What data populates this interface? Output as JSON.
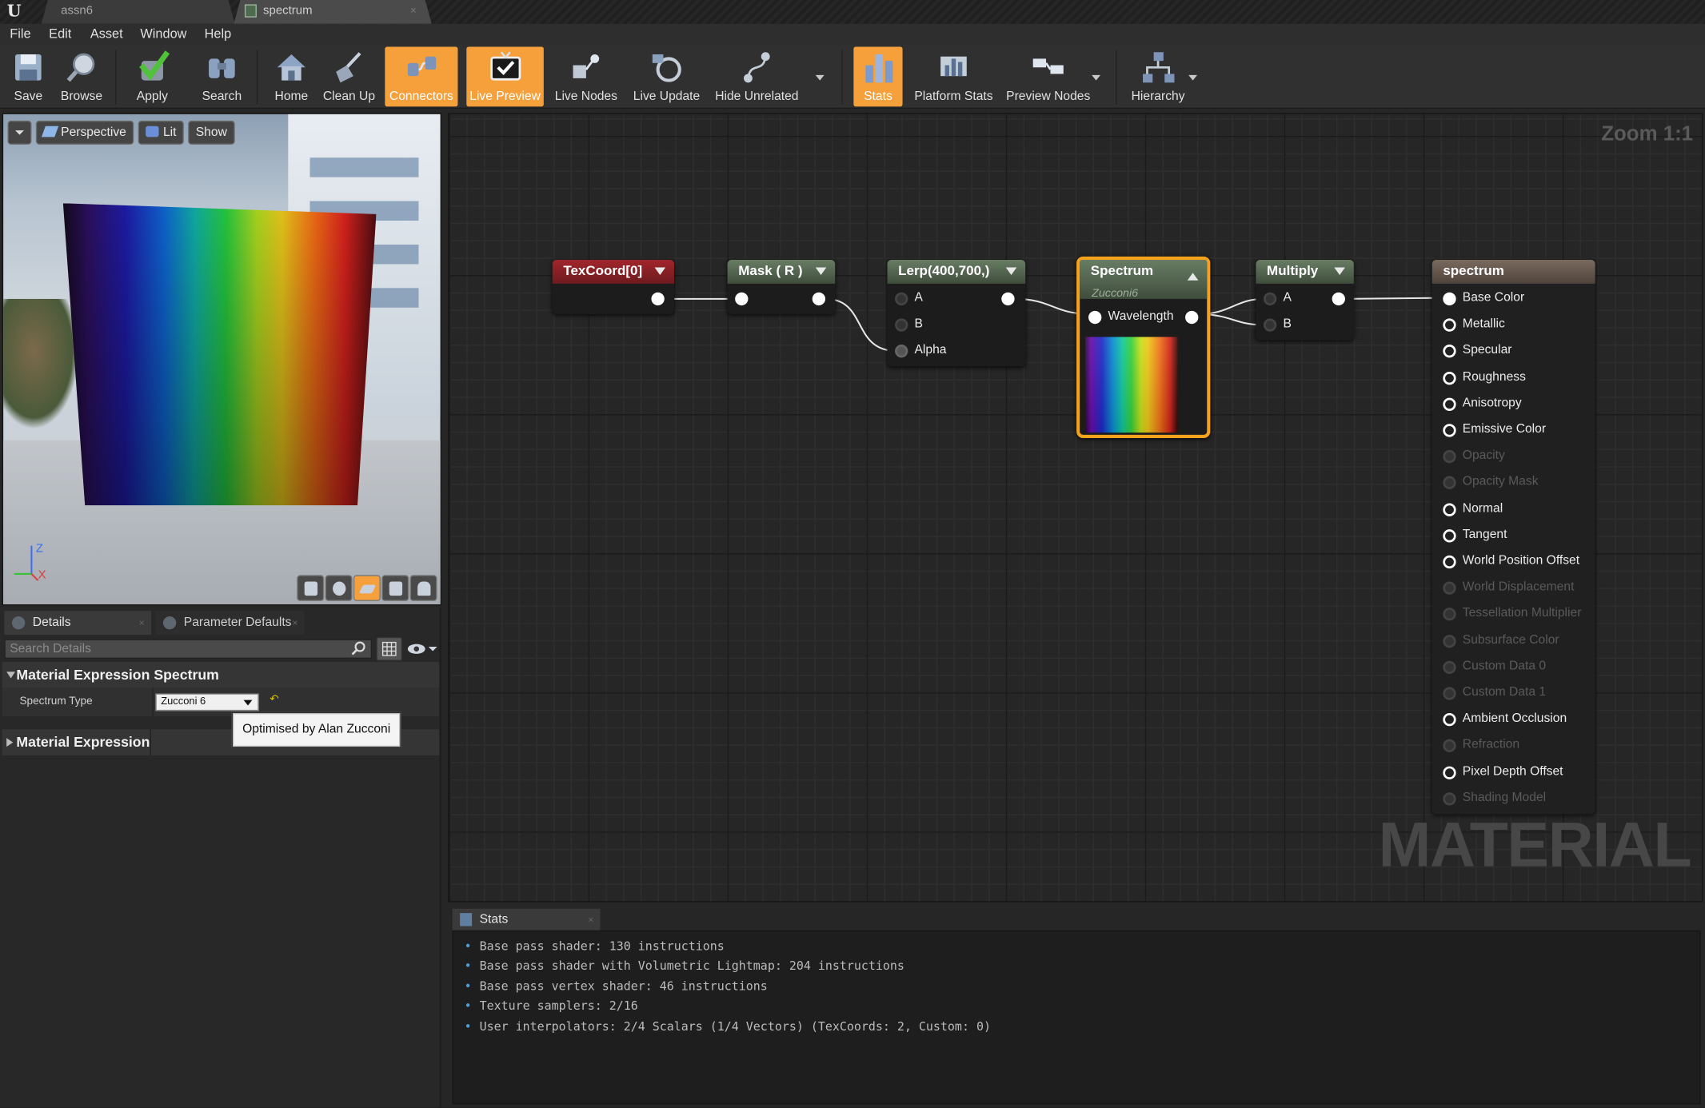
{
  "tabs": [
    {
      "label": "assn6"
    },
    {
      "label": "spectrum"
    }
  ],
  "menu": [
    "File",
    "Edit",
    "Asset",
    "Window",
    "Help"
  ],
  "toolbar": {
    "buttons": [
      {
        "label": "Save",
        "icon": "save-icon"
      },
      {
        "label": "Browse",
        "icon": "browse-icon"
      },
      {
        "label": "Apply",
        "icon": "apply-check-icon"
      },
      {
        "label": "Search",
        "icon": "search-binoculars-icon"
      },
      {
        "label": "Home",
        "icon": "home-icon"
      },
      {
        "label": "Clean Up",
        "icon": "broom-icon"
      },
      {
        "label": "Connectors",
        "icon": "connectors-icon",
        "active": true
      },
      {
        "label": "Live Preview",
        "icon": "tv-check-icon",
        "active": true
      },
      {
        "label": "Live Nodes",
        "icon": "live-nodes-icon"
      },
      {
        "label": "Live Update",
        "icon": "live-update-icon"
      },
      {
        "label": "Hide Unrelated",
        "icon": "hide-unrelated-icon"
      },
      {
        "label": "Stats",
        "icon": "stats-bars-icon",
        "active": true
      },
      {
        "label": "Platform Stats",
        "icon": "platform-stats-icon"
      },
      {
        "label": "Preview Nodes",
        "icon": "preview-nodes-icon"
      },
      {
        "label": "Hierarchy",
        "icon": "hierarchy-icon"
      }
    ],
    "accent": "#f5a03a"
  },
  "viewport": {
    "view_mode": "Perspective",
    "lighting": "Lit",
    "show": "Show",
    "axis_z": "Z",
    "axis_x": "X"
  },
  "details": {
    "tab_details": "Details",
    "tab_params": "Parameter Defaults",
    "search_placeholder": "Search Details",
    "category_spectrum": "Material Expression Spectrum",
    "spectrum_type_label": "Spectrum Type",
    "spectrum_type_value": "Zucconi 6",
    "category_material": "Material Expression",
    "tooltip": "Optimised by Alan Zucconi"
  },
  "graph": {
    "zoom": "Zoom 1:1",
    "watermark": "MATERIAL",
    "nodes": {
      "texcoord": {
        "title": "TexCoord[0]"
      },
      "mask": {
        "title": "Mask ( R )"
      },
      "lerp": {
        "title": "Lerp(400,700,)",
        "inputs": [
          "A",
          "B",
          "Alpha"
        ]
      },
      "spectrum": {
        "title": "Spectrum",
        "subtitle": "Zucconi6",
        "input": "Wavelength"
      },
      "multiply": {
        "title": "Multiply",
        "inputs": [
          "A",
          "B"
        ]
      },
      "result": {
        "title": "spectrum",
        "inputs": [
          {
            "label": "Base Color",
            "enabled": true
          },
          {
            "label": "Metallic",
            "enabled": true
          },
          {
            "label": "Specular",
            "enabled": true
          },
          {
            "label": "Roughness",
            "enabled": true
          },
          {
            "label": "Anisotropy",
            "enabled": true
          },
          {
            "label": "Emissive Color",
            "enabled": true
          },
          {
            "label": "Opacity",
            "enabled": false
          },
          {
            "label": "Opacity Mask",
            "enabled": false
          },
          {
            "label": "Normal",
            "enabled": true
          },
          {
            "label": "Tangent",
            "enabled": true
          },
          {
            "label": "World Position Offset",
            "enabled": true
          },
          {
            "label": "World Displacement",
            "enabled": false
          },
          {
            "label": "Tessellation Multiplier",
            "enabled": false
          },
          {
            "label": "Subsurface Color",
            "enabled": false
          },
          {
            "label": "Custom Data 0",
            "enabled": false
          },
          {
            "label": "Custom Data 1",
            "enabled": false
          },
          {
            "label": "Ambient Occlusion",
            "enabled": true
          },
          {
            "label": "Refraction",
            "enabled": false
          },
          {
            "label": "Pixel Depth Offset",
            "enabled": true
          },
          {
            "label": "Shading Model",
            "enabled": false
          }
        ]
      }
    }
  },
  "stats": {
    "tab": "Stats",
    "lines": [
      "Base pass shader: 130 instructions",
      "Base pass shader with Volumetric Lightmap: 204 instructions",
      "Base pass vertex shader: 46 instructions",
      "Texture samplers: 2/16",
      "User interpolators: 2/4 Scalars (1/4 Vectors) (TexCoords: 2, Custom: 0)"
    ]
  }
}
